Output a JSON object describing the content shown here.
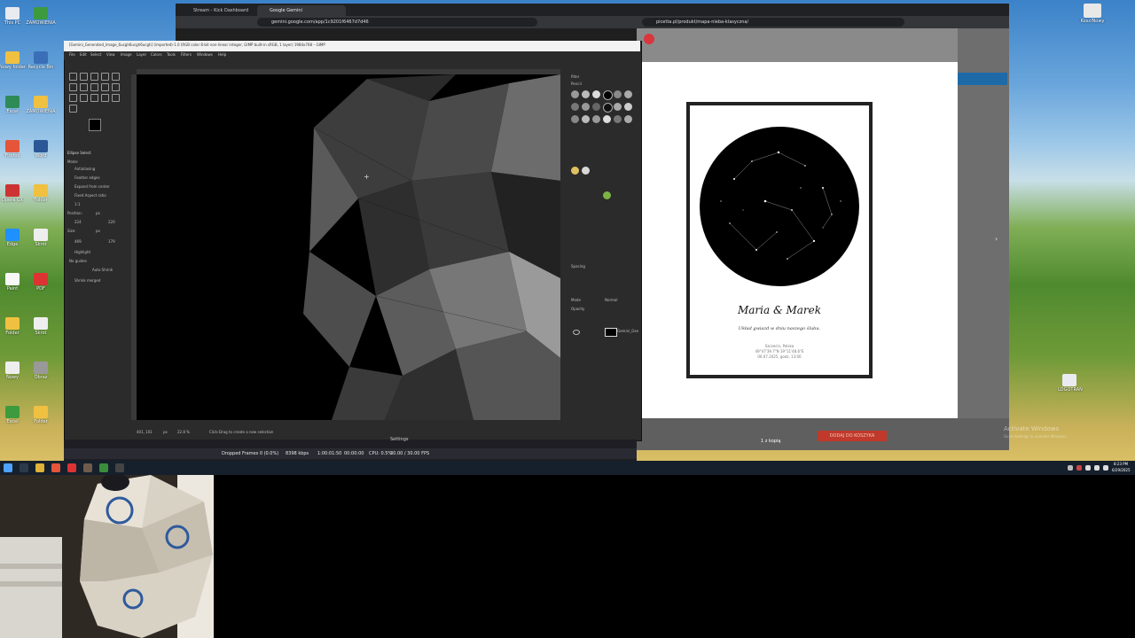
{
  "desktop": {
    "left_icon_labels": [
      "This PC",
      "ZAMÓWIENIA",
      "Nowy folder",
      "Recycle Bin",
      "Excel",
      "ZAMÓWIENIA",
      "Firefox",
      "Word",
      "Opera GX",
      "Folder",
      "Edge",
      "Skrót",
      "Paint",
      "PDF",
      "Folder",
      "Skrót",
      "Nowy",
      "Obraz",
      "Excel",
      "Folder"
    ],
    "right_icon_label": "Kosz/Nowy",
    "right_icon_label_2": "LOGOTRAN"
  },
  "browser": {
    "tab1": "Stream - Kick Dashboard",
    "tab2": "Google Gemini",
    "url": "gemini.google.com/app/1c9201f6467d7d46"
  },
  "right_browser": {
    "url": "picetta.pl/produkt/mapa-nieba-klasyczna/",
    "poster_title": "Maria & Marek",
    "poster_subtitle": "Układ gwiazd w dniu naszego ślubu.",
    "poster_meta_1": "Szczecin, Polska",
    "poster_meta_2": "49°47'39.7\"N 19°11'48.6\"E",
    "poster_meta_3": "06.07.2025, godz. 13:00",
    "page_count": "1 z kopią",
    "cart_button": "DODAJ DO KOSZYKA",
    "watermark_1": "Activate Windows",
    "watermark_2": "Go to Settings to activate Windows."
  },
  "gimp": {
    "title": "[Gemini_Generated_Image_6ucgh6ucgh6ucgh] (imported)-1.0 (RGB color 8-bit non-linear integer, GIMP built-in sRGB, 1 layer) 1984x768 – GIMP",
    "menu": [
      "File",
      "Edit",
      "Select",
      "View",
      "Image",
      "Layer",
      "Colors",
      "Tools",
      "Filters",
      "Windows",
      "Help"
    ],
    "tool_options": {
      "heading": "Ellipse Select",
      "mode": "Mode:",
      "antialiasing": "Antialiasing",
      "feather": "Feather edges",
      "expand": "Expand from center",
      "fixed": "Fixed Aspect ratio",
      "ratio": "1:1",
      "position_label": "Position:",
      "px1": "px",
      "pos_x": "224",
      "pos_y": "220",
      "size_label": "Size:",
      "px2": "px",
      "size_w": "469",
      "size_h": "179",
      "highlight": "Highlight",
      "no_guides": "No guides",
      "auto_shrink": "Auto Shrink",
      "shrink_merged": "Shrink merged"
    },
    "status": {
      "coords": "401, 101",
      "unit": "px",
      "zoom": "22.8 %",
      "message": "Click-Drag to create a new selection"
    },
    "right_dock": {
      "brush_filter": "filter",
      "brush_name": "Pencil",
      "spacing": "Spacing",
      "mode": "Mode",
      "mode_value": "Normal",
      "opacity": "Opacity",
      "layer_name": "Gemini_Gen"
    }
  },
  "obs": {
    "settings": "Settings",
    "dropped": "Dropped Frames 0 (0.0%)",
    "bitrate": "8398 kbps",
    "time1": "1:00:01:50",
    "time2": "00:00:00",
    "cpu": "CPU: 0.5%",
    "fps": "30.00 / 30.00 FPS"
  },
  "clock": {
    "time": "8:23 PM",
    "date": "6/29/2025"
  },
  "colors": {
    "accent_red": "#c0392b",
    "gimp_bg": "#2b2b2b",
    "taskbar": "#16202c"
  }
}
